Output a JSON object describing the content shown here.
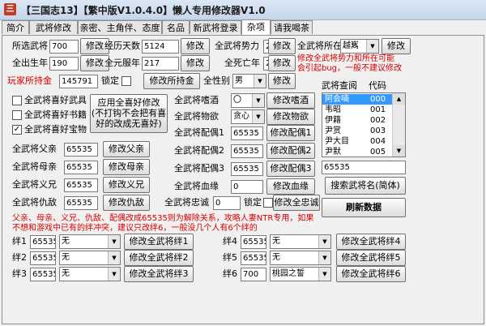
{
  "window": {
    "title": "【三国志13】【繁中版V1.0.4.0】懒人专用修改器V1.0",
    "icon_text": "三"
  },
  "tabs": [
    "简介",
    "武将修改",
    "亲密、主角伴、态度",
    "名品",
    "新武将登录",
    "杂项",
    "请我喝茶"
  ],
  "active_tab": 5,
  "labels": {
    "selected": "所选武将",
    "experience_days": "经历天数",
    "all_power": "全武将势力",
    "all_location": "全武将所在",
    "birth_year": "全出生年",
    "coming_of_age": "全元服年",
    "death_year": "全死亡年",
    "player_gold": "玩家所持金",
    "lock": "锁定",
    "all_gender": "全性别",
    "fav_gear": "全武将喜好武具",
    "fav_book": "全武将喜好书籍",
    "fav_treasure": "全武将喜好宝物",
    "father": "全武将父亲",
    "mother": "全武将母亲",
    "brother": "全武将义兄",
    "enemy": "全武将仇敌",
    "hobby": "全武将嗜酒",
    "desire": "全武将物欲",
    "spouse1": "全武将配偶1",
    "spouse2": "全武将配偶2",
    "spouse3": "全武将配偶3",
    "blood": "全武将血缘",
    "loyalty": "全武将忠诚",
    "lock2": "锁定",
    "query": "武将查阅",
    "code": "代码"
  },
  "values": {
    "selected": "700",
    "experience_days": "5124",
    "all_power": "255",
    "location": "越嶲",
    "birth_year": "190",
    "coming_of_age": "217",
    "death_year": "225",
    "player_gold": "145791",
    "gender": "男",
    "father": "65535",
    "mother": "65535",
    "brother": "65535",
    "enemy": "65535",
    "hobby": "〇",
    "desire": "贪心",
    "spouse1": "65535",
    "spouse2": "65535",
    "spouse3": "65535",
    "blood": "0",
    "loyalty": "0",
    "search_code": "65535"
  },
  "buttons": {
    "modify": "修改",
    "modify_gold": "修改所持金",
    "apply_fav": "应用全喜好修改",
    "apply_fav_note1": "(不打钩不会把有喜",
    "apply_fav_note2": "好的改成无喜好)",
    "father": "修改父亲",
    "mother": "修改母亲",
    "brother": "修改义兄",
    "enemy": "修改仇敌",
    "hobby": "修改嗜酒",
    "desire": "修改物欲",
    "spouse1": "修改配偶1",
    "spouse2": "修改配偶2",
    "spouse3": "修改配偶3",
    "blood": "修改血缘",
    "loyalty": "修改全忠诚",
    "search": "搜索武将名(简体)",
    "refresh": "刷新数据",
    "bond1": "修改全武将绊1",
    "bond2": "修改全武将绊2",
    "bond3": "修改全武将绊3",
    "bond4": "修改全武将绊4",
    "bond5": "修改全武将绊5",
    "bond6": "修改全武将绊6"
  },
  "notes": {
    "power_note1": "修改全武将势力和所在可能",
    "power_note2": "会引起bug，一般不建议修改",
    "family_note1": "父亲、母亲、义兄、仇敌、配偶改成65535则为解除关系，攻略人妻NTR专用，如果",
    "family_note2": "不想和游戏中已有的绊冲突，建议只改绊6，一般没几个人有6个绊的"
  },
  "checkbox_state": {
    "fav_gear": false,
    "fav_book": false,
    "fav_treasure": true,
    "lock": false,
    "lock2": false
  },
  "general_list": [
    {
      "name": "阿会喃",
      "code": "000"
    },
    {
      "name": "韦昭",
      "code": "001"
    },
    {
      "name": "伊籍",
      "code": "002"
    },
    {
      "name": "尹赏",
      "code": "003"
    },
    {
      "name": "尹大目",
      "code": "004"
    },
    {
      "name": "尹默",
      "code": "005"
    }
  ],
  "bonds": [
    {
      "label": "绊1",
      "value": "65535",
      "type": "无"
    },
    {
      "label": "绊2",
      "value": "65535",
      "type": "无"
    },
    {
      "label": "绊3",
      "value": "65535",
      "type": "无"
    },
    {
      "label": "绊4",
      "value": "65535",
      "type": "无"
    },
    {
      "label": "绊5",
      "value": "65535",
      "type": "无"
    },
    {
      "label": "绊6",
      "value": "700",
      "type": "桃园之誓"
    }
  ],
  "colors": {
    "note_red": "#d40000",
    "selection": "#3399ff"
  },
  "icons": {
    "dropdown": "chevron-down-icon",
    "check": "check-icon"
  }
}
